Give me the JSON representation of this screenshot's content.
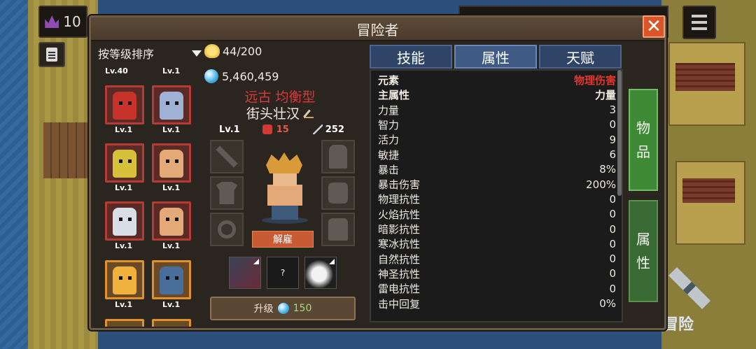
{
  "topbar": {
    "left_value": "10"
  },
  "window": {
    "title": "冒险者",
    "close_label": "✕"
  },
  "sort": {
    "label": "按等级排序"
  },
  "hero_list": {
    "top_levels": [
      "Lv.40",
      "Lv.1"
    ],
    "rows": [
      [
        "Lv.1",
        "Lv.1"
      ],
      [
        "Lv.1",
        "Lv.1"
      ],
      [
        "Lv.1",
        "Lv.1"
      ],
      [
        "Lv.1",
        "Lv.1"
      ]
    ]
  },
  "resources": {
    "gold": "44/200",
    "gems": "5,460,459"
  },
  "hero": {
    "type": "远古 均衡型",
    "name": "街头壮汉",
    "level": "Lv.1",
    "attack": "15",
    "durability": "252",
    "dismiss_label": "解雇",
    "skill_unknown": "?"
  },
  "upgrade": {
    "label": "升级",
    "cost": "150"
  },
  "tabs": [
    "技能",
    "属性",
    "天赋"
  ],
  "active_tab": "属性",
  "attributes": [
    {
      "k": "元素",
      "v": "物理伤害",
      "bold": true,
      "red": true
    },
    {
      "k": "主属性",
      "v": "力量",
      "bold": true
    },
    {
      "k": "力量",
      "v": "3"
    },
    {
      "k": "智力",
      "v": "0"
    },
    {
      "k": "活力",
      "v": "9"
    },
    {
      "k": "敏捷",
      "v": "6"
    },
    {
      "k": "暴击",
      "v": "8%"
    },
    {
      "k": "暴击伤害",
      "v": "200%"
    },
    {
      "k": "物理抗性",
      "v": "0"
    },
    {
      "k": "火焰抗性",
      "v": "0"
    },
    {
      "k": "暗影抗性",
      "v": "0"
    },
    {
      "k": "寒冰抗性",
      "v": "0"
    },
    {
      "k": "自然抗性",
      "v": "0"
    },
    {
      "k": "神圣抗性",
      "v": "0"
    },
    {
      "k": "雷电抗性",
      "v": "0"
    },
    {
      "k": "击中回复",
      "v": "0%"
    }
  ],
  "side_buttons": {
    "items": "物品",
    "attributes": "属性"
  },
  "corner": {
    "adventure_label": "冒险"
  },
  "colors": {
    "accent_red": "#e0362c",
    "tab_active": "#405a86",
    "side_green": "#3f8a36"
  }
}
